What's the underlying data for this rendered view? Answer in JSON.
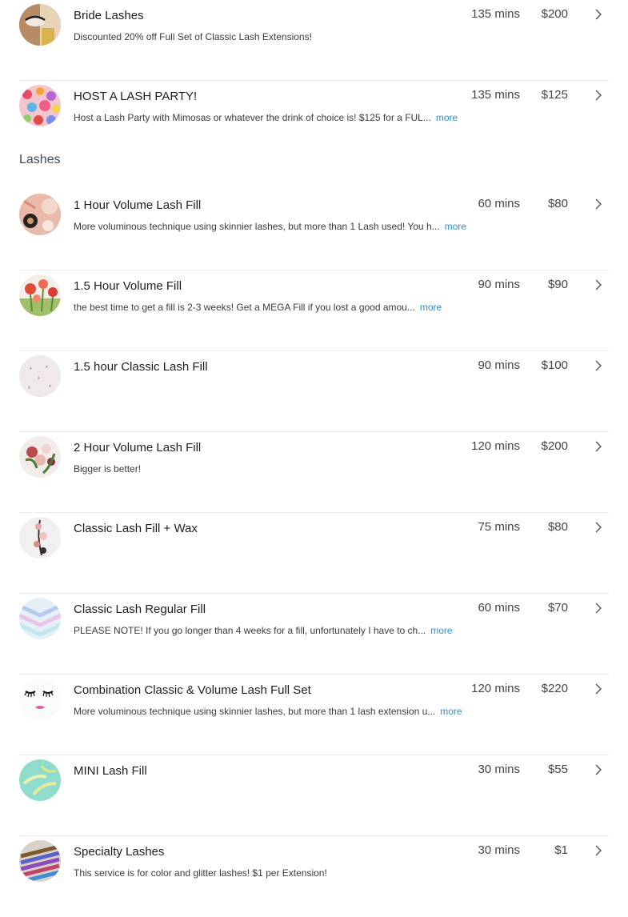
{
  "services_top": [
    {
      "name": "Bride Lashes",
      "description": "Discounted 20% off Full Set of Classic Lash Extensions!",
      "more": "",
      "duration": "135 mins",
      "price": "$200",
      "thumb": "bride-lashes-photo"
    },
    {
      "name": "HOST A LASH PARTY!",
      "description": "Host a Lash Party with Mimosas or whatever the drink of choice is! $125 for a FUL...",
      "more": "more",
      "duration": "135 mins",
      "price": "$125",
      "thumb": "glitter-photo"
    }
  ],
  "section": {
    "title": "Lashes"
  },
  "services_lashes": [
    {
      "name": "1 Hour Volume Lash Fill",
      "description": "More voluminous technique using skinnier lashes, but more than 1 Lash used! You h...",
      "more": "more",
      "duration": "60 mins",
      "price": "$80",
      "thumb": "pink-accessories-photo"
    },
    {
      "name": "1.5 Hour Volume Fill",
      "description": "the best time to get a fill is 2-3 weeks! Get a MEGA Fill if you lost a good amou...",
      "more": "more",
      "duration": "90 mins",
      "price": "$90",
      "thumb": "flowers-photo"
    },
    {
      "name": "1.5 hour Classic Lash Fill",
      "description": "",
      "more": "",
      "duration": "90 mins",
      "price": "$100",
      "thumb": "pattern-photo"
    },
    {
      "name": "2 Hour Volume Lash Fill",
      "description": "Bigger is better!",
      "more": "",
      "duration": "120 mins",
      "price": "$200",
      "thumb": "bouquet-photo"
    },
    {
      "name": "Classic Lash Fill + Wax",
      "description": "",
      "more": "",
      "duration": "75 mins",
      "price": "$80",
      "thumb": "branch-photo"
    },
    {
      "name": "Classic Lash Regular Fill",
      "description": "PLEASE NOTE! If you go longer than 4 weeks for a fill, unfortunately I have to ch...",
      "more": "more",
      "duration": "60 mins",
      "price": "$70",
      "thumb": "holographic-chevron-photo"
    },
    {
      "name": "Combination Classic & Volume Lash Full Set",
      "description": "More voluminous technique using skinnier lashes, but more than 1 lash extension u...",
      "more": "more",
      "duration": "120 mins",
      "price": "$220",
      "thumb": "lashes-lips-illustration"
    },
    {
      "name": "MINI Lash Fill",
      "description": "",
      "more": "",
      "duration": "30 mins",
      "price": "$55",
      "thumb": "mint-leaves-photo"
    },
    {
      "name": "Specialty Lashes",
      "description": "This service is for color and glitter lashes! $1 per Extension!",
      "more": "",
      "duration": "30 mins",
      "price": "$1",
      "thumb": "colored-lashes-photo"
    }
  ],
  "icons": {
    "chevron": "chevron-right-icon"
  },
  "colors": {
    "link": "#2f8fd0",
    "section_title": "#3d4d5c",
    "divider": "#ececec"
  }
}
